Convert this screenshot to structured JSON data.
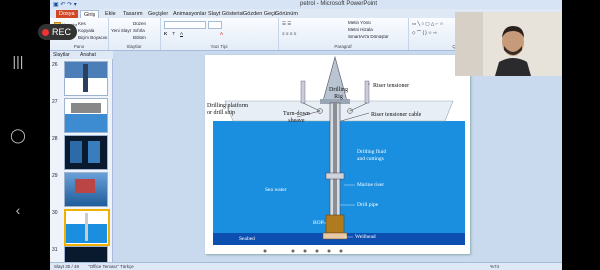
{
  "recording": {
    "label": "REC"
  },
  "app": {
    "title": "petrol - Microsoft PowerPoint",
    "tabs": [
      "Dosya",
      "Giriş",
      "Ekle",
      "Tasarım",
      "Geçişler",
      "Animasyonlar",
      "Slayt Gösterisi",
      "Gözden Geçir",
      "Görünüm"
    ],
    "active_tab": "Giriş"
  },
  "ribbon": {
    "groups": [
      {
        "label": "Pano",
        "items": [
          "Yapıştır",
          "Kes",
          "Kopyala",
          "Biçim Boyacısı"
        ]
      },
      {
        "label": "Slaytlar",
        "items": [
          "Yeni Slayt",
          "Düzen",
          "Sıfırla",
          "Bölüm"
        ]
      },
      {
        "label": "Yazı Tipi",
        "items": []
      },
      {
        "label": "Paragraf",
        "items": [
          "Metin Yönü",
          "Metni Hizala",
          "SmartArt'a Dönüştür"
        ]
      },
      {
        "label": "Çizim",
        "items": [
          "Yerleştir",
          "Hızlı Stiller"
        ]
      }
    ]
  },
  "pane": {
    "tabs": [
      "Slaytlar",
      "Anahat"
    ],
    "thumb_numbers": [
      "26",
      "27",
      "28",
      "29",
      "30",
      "31"
    ],
    "selected": "30"
  },
  "slide": {
    "labels": {
      "drilling_rig": "Drilling\nRig",
      "riser_tensioner": "Riser tensioner",
      "drilling_platform": "Drilling platform\nor drill ship",
      "turn_down": "Turn-down\nsheave",
      "riser_cable": "Riser tensioner cable",
      "drilling_fluid": "Drilling fluid\nand cuttings",
      "sea_water": "Sea water",
      "marine_riser": "Marine riser",
      "drill_pipe": "Drill pipe",
      "bop": "BOP",
      "seabed": "Seabed",
      "wellhead": "Wellhead"
    }
  },
  "status": {
    "slide_info": "Slayt 30 / 48",
    "theme": "\"Office Teması\"",
    "language": "Türkçe",
    "zoom": "%74"
  },
  "colors": {
    "sea": "#1a8fe0",
    "seabed": "#0d4fb0",
    "office_file": "#d24726"
  }
}
